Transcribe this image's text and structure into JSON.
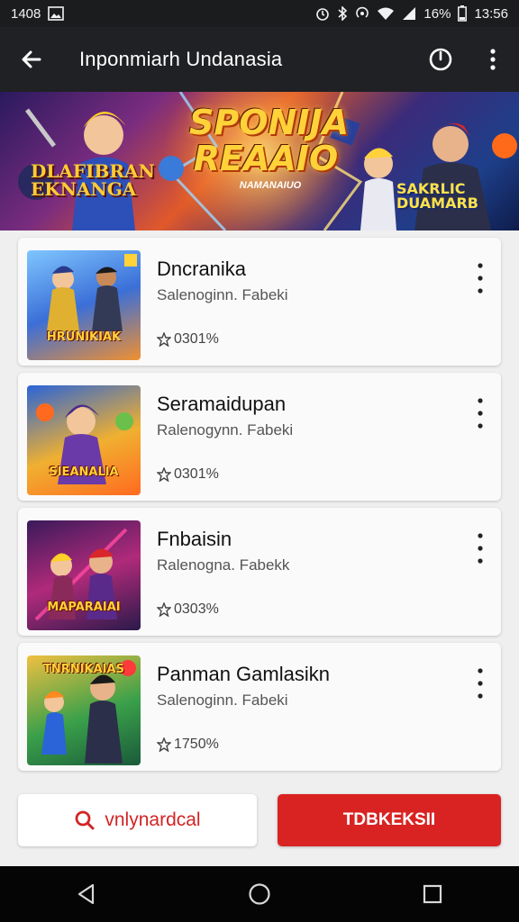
{
  "status_bar": {
    "time_left": "1408",
    "battery": "16%",
    "time_right": "13:56",
    "icons": [
      "image-icon",
      "alarm-icon",
      "bluetooth-icon",
      "hotspot-icon",
      "wifi-icon",
      "signal-icon",
      "battery-icon"
    ]
  },
  "app_bar": {
    "title": "Inponmiarh Undanasia",
    "icons": [
      "back-arrow-icon",
      "power-icon",
      "more-vert-icon"
    ]
  },
  "banner": {
    "title": "SPONIJA REAAIO",
    "subtitle": "NAMANAIUO",
    "left_text": "DLAFIBRAN EKNANGA",
    "right_text": "SAKRLIC DUAMARB"
  },
  "games": [
    {
      "title": "Dncranika",
      "subtitle": "Salenoginn. Fabeki",
      "rating": "0301%",
      "thumb_label": "HRUNIKIAK"
    },
    {
      "title": "Seramaidupan",
      "subtitle": "Ralenogynn. Fabeki",
      "rating": "0301%",
      "thumb_label": "SIEANALIA"
    },
    {
      "title": "Fnbaisin",
      "subtitle": "Ralenogna. Fabekk",
      "rating": "0303%",
      "thumb_label": "MAPARAIAI"
    },
    {
      "title": "Panman Gamlasikn",
      "subtitle": "Salenoginn. Fabeki",
      "rating": "1750%",
      "thumb_label": "TNRNIKAIAS"
    }
  ],
  "actions": {
    "search_label": "vnlynardcal",
    "primary_label": "TDBKEKSII"
  },
  "colors": {
    "accent": "#d92323",
    "app_bar": "#1f2124",
    "status_bar": "#1b1c1e",
    "background": "#efefef"
  },
  "nav_bar": {
    "icons": [
      "nav-back-icon",
      "nav-home-icon",
      "nav-recents-icon"
    ]
  }
}
